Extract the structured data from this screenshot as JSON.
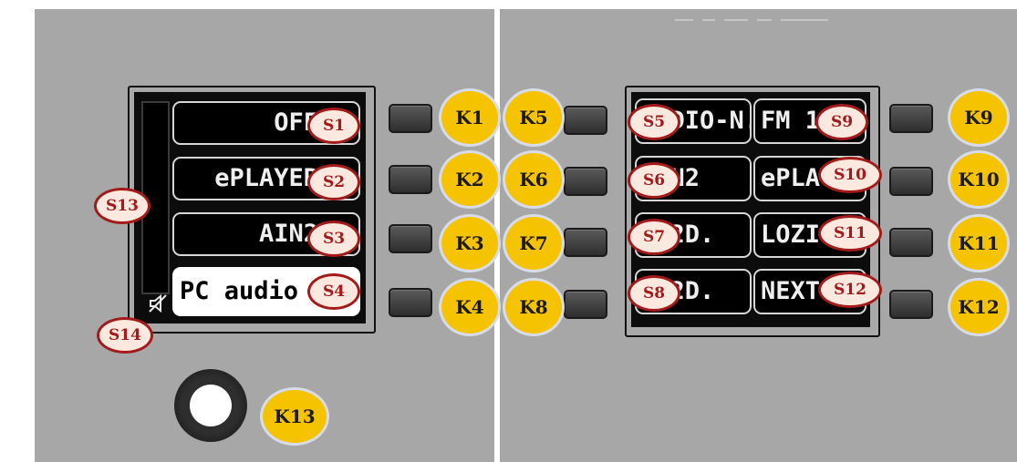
{
  "left_screen": {
    "keys": [
      {
        "text": "OFF",
        "marker": "S1"
      },
      {
        "text": "ePLAYER",
        "marker": "S2"
      },
      {
        "text": "AIN2",
        "marker": "S3"
      },
      {
        "text": "PC audio",
        "marker": "S4",
        "active": true
      }
    ],
    "bar_marker": "S13",
    "mute_marker": "S14"
  },
  "right_screen": {
    "col1": [
      {
        "text": "RADIO-N.",
        "marker": "S5"
      },
      {
        "text": "AIN2",
        "marker": "S6"
      },
      {
        "text": "ZZ2D.",
        "marker": "S7"
      },
      {
        "text": "ZZ2D.",
        "marker": "S8"
      }
    ],
    "col2": [
      {
        "text": "FM 1",
        "marker": "S9"
      },
      {
        "text": "ePLAYER",
        "marker": "S10"
      },
      {
        "text": "LOZI",
        "marker": "S11"
      },
      {
        "text": "NEXT",
        "marker": "S12"
      }
    ]
  },
  "keys": {
    "left_column": [
      "K1",
      "K2",
      "K3",
      "K4"
    ],
    "middle_column": [
      "K5",
      "K6",
      "K7",
      "K8"
    ],
    "right_column": [
      "K9",
      "K10",
      "K11",
      "K12"
    ],
    "knob": "K13"
  },
  "colors": {
    "panel": "#a7a7a7",
    "key_badge": "#f6c300",
    "marker_border": "#a31a1a",
    "screen": "#0c0c0c"
  }
}
